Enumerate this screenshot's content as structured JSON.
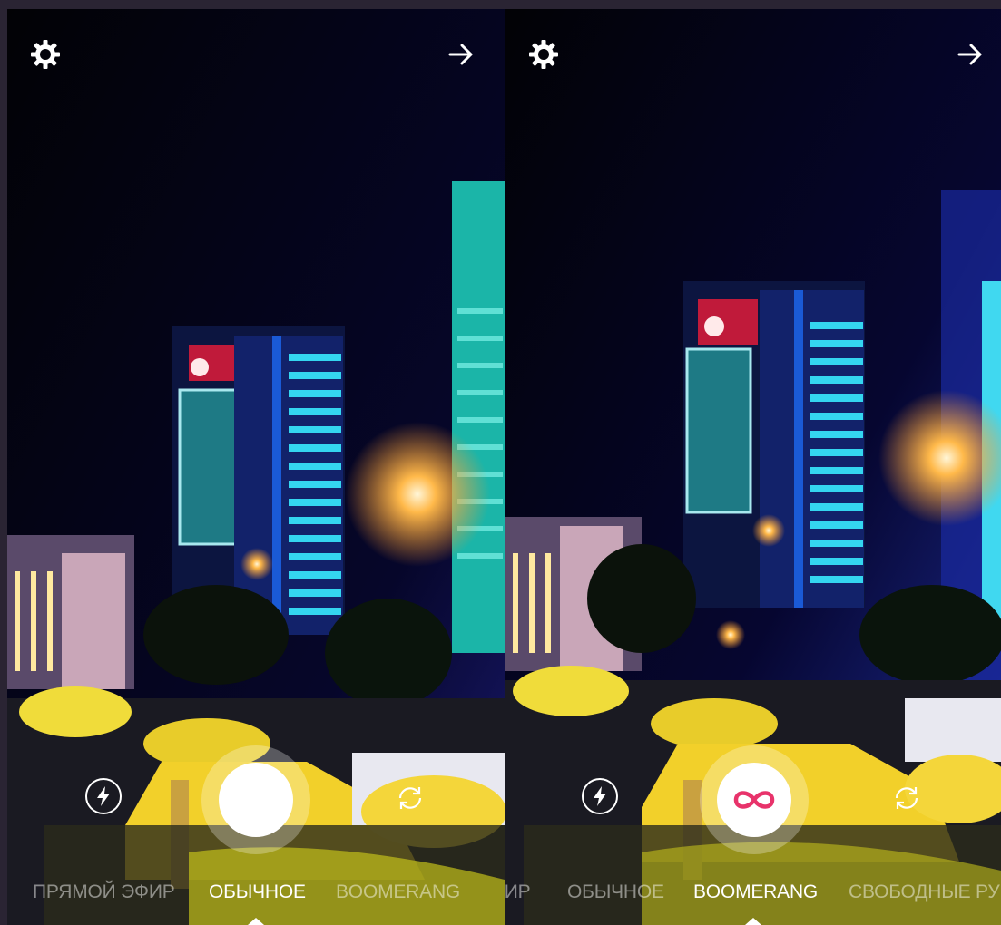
{
  "screens": [
    {
      "icons": {
        "settings": "gear-icon",
        "next": "arrow-right-icon",
        "flash": "flash-icon",
        "flip": "flip-camera-icon"
      },
      "modes": [
        "ПРЯМОЙ ЭФИР",
        "ОБЫЧНОЕ",
        "BOOMERANG"
      ],
      "active_mode": "ОБЫЧНОЕ"
    },
    {
      "icons": {
        "settings": "gear-icon",
        "next": "arrow-right-icon",
        "flash": "flash-icon",
        "flip": "flip-camera-icon",
        "shutter": "infinity-icon"
      },
      "modes": [
        "ФИР",
        "ОБЫЧНОЕ",
        "BOOMERANG",
        "СВОБОДНЫЕ РУКИ"
      ],
      "active_mode": "BOOMERANG",
      "accent_color": "#e8336b"
    }
  ]
}
